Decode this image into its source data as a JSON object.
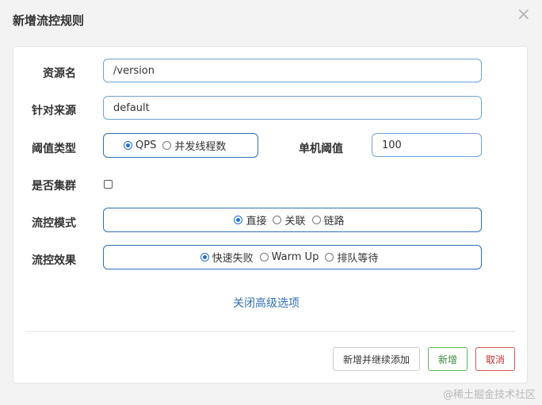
{
  "dialog": {
    "title": "新增流控规则",
    "close_glyph": "×"
  },
  "form": {
    "resource": {
      "label": "资源名",
      "value": "/version"
    },
    "limit_app": {
      "label": "针对来源",
      "value": "default"
    },
    "grade": {
      "label": "阈值类型",
      "options": [
        "QPS",
        "并发线程数"
      ],
      "selected": "QPS"
    },
    "count": {
      "label": "单机阈值",
      "value": "100"
    },
    "cluster": {
      "label": "是否集群",
      "checked": false
    },
    "strategy": {
      "label": "流控模式",
      "options": [
        "直接",
        "关联",
        "链路"
      ],
      "selected": "直接"
    },
    "control_behavior": {
      "label": "流控效果",
      "options": [
        "快速失败",
        "Warm Up",
        "排队等待"
      ],
      "selected": "快速失败"
    },
    "advanced_toggle": "关闭高级选项"
  },
  "footer": {
    "add_continue": "新增并继续添加",
    "add": "新增",
    "cancel": "取消"
  },
  "watermark": "@稀土掘金技术社区",
  "icons": {
    "close": "close-icon"
  }
}
